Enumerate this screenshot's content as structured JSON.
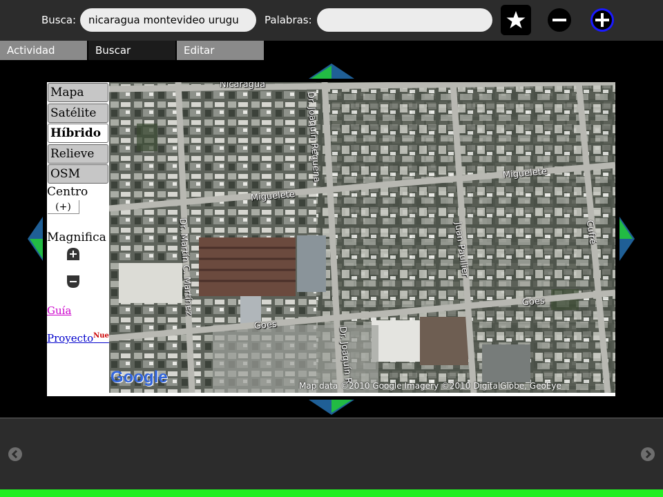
{
  "toolbar": {
    "search_label": "Busca:",
    "search_value": "nicaragua montevideo urugu",
    "words_label": "Palabras:",
    "words_value": "",
    "star_icon": "star-icon",
    "zoom_out_icon": "minus-circle-icon",
    "zoom_in_icon": "plus-circle-icon"
  },
  "tabs": [
    {
      "label": "Actividad"
    },
    {
      "label": "Buscar"
    },
    {
      "label": "Editar"
    }
  ],
  "sidebar": {
    "map_types": [
      {
        "label": "Mapa"
      },
      {
        "label": "Satélite"
      },
      {
        "label": "Híbrido"
      },
      {
        "label": "Relieve"
      },
      {
        "label": "OSM"
      }
    ],
    "active_map_type": "Híbrido",
    "centro_label": "Centro",
    "centro_button": "(+)",
    "magnifica_label": "Magnifica",
    "guia_link": "Guía",
    "proyecto_link": "Proyecto",
    "proyecto_badge": "Nue"
  },
  "map": {
    "streets": {
      "nicaragua": "Nicaragua",
      "requena": "Dr. Joaquín Requena",
      "miguelete_left": "Miguelete",
      "miguelete_right": "Miguelete",
      "martinez": "Dr. Martín C. Martínez",
      "pauller": "Juan Paullier",
      "cufre": "Cufré",
      "goes_left": "Goes",
      "goes_right": "Goes",
      "requena_bottom": "Dr. Joaquín R"
    },
    "logo": "Google",
    "attribution": "Map data ©2010 Google  Imagery ©2010 DigitalGlobe, GeoEye"
  },
  "colors": {
    "toolbar_bg": "#2c2c2c",
    "arrow_blue": "#1f5f96",
    "arrow_green": "#22bb44",
    "status_green": "#22ee22",
    "guia_link": "#cc00cc",
    "proyecto_link": "#0000cc",
    "badge_red": "#cc0000"
  }
}
